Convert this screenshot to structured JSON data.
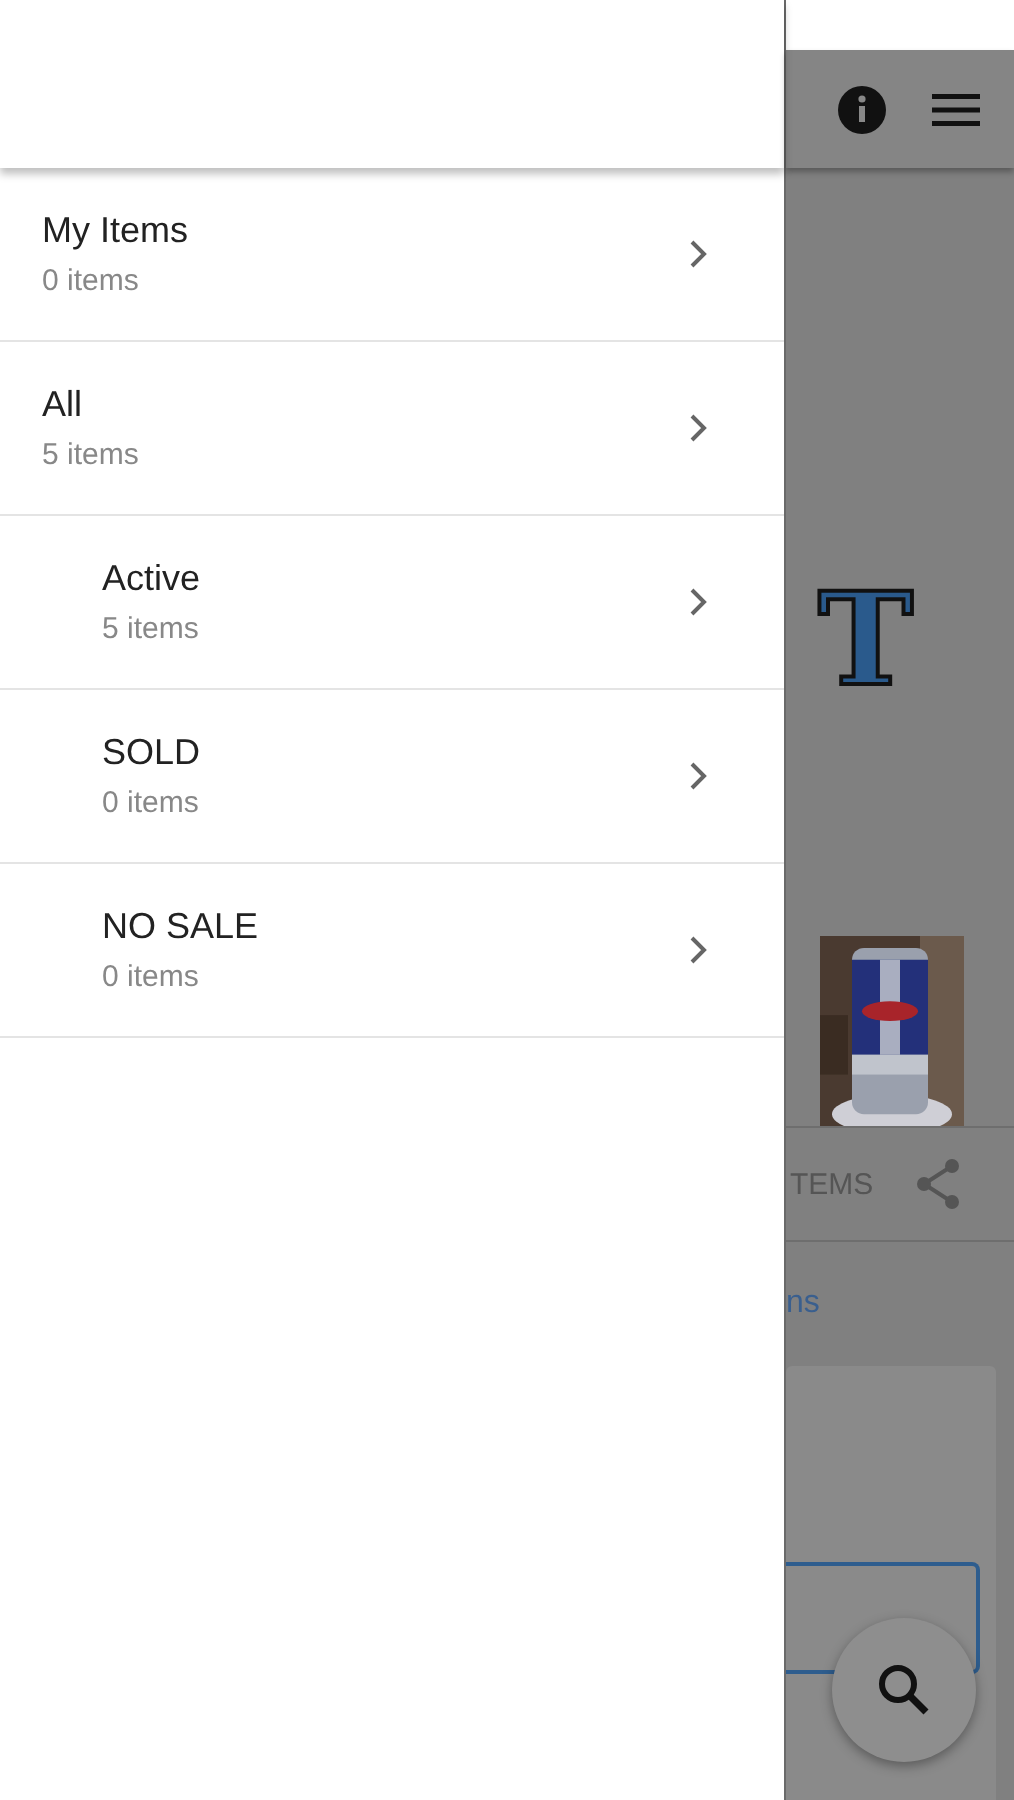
{
  "drawer": {
    "items": [
      {
        "title": "My Items",
        "count": "0 items"
      },
      {
        "title": "All",
        "count": "5 items",
        "children": [
          {
            "title": "Active",
            "count": "5 items"
          },
          {
            "title": "SOLD",
            "count": "0 items"
          },
          {
            "title": "NO SALE",
            "count": "0 items"
          }
        ]
      }
    ]
  },
  "background": {
    "logo_text": "T",
    "tab_label": "TEMS",
    "link_text": "ns"
  }
}
